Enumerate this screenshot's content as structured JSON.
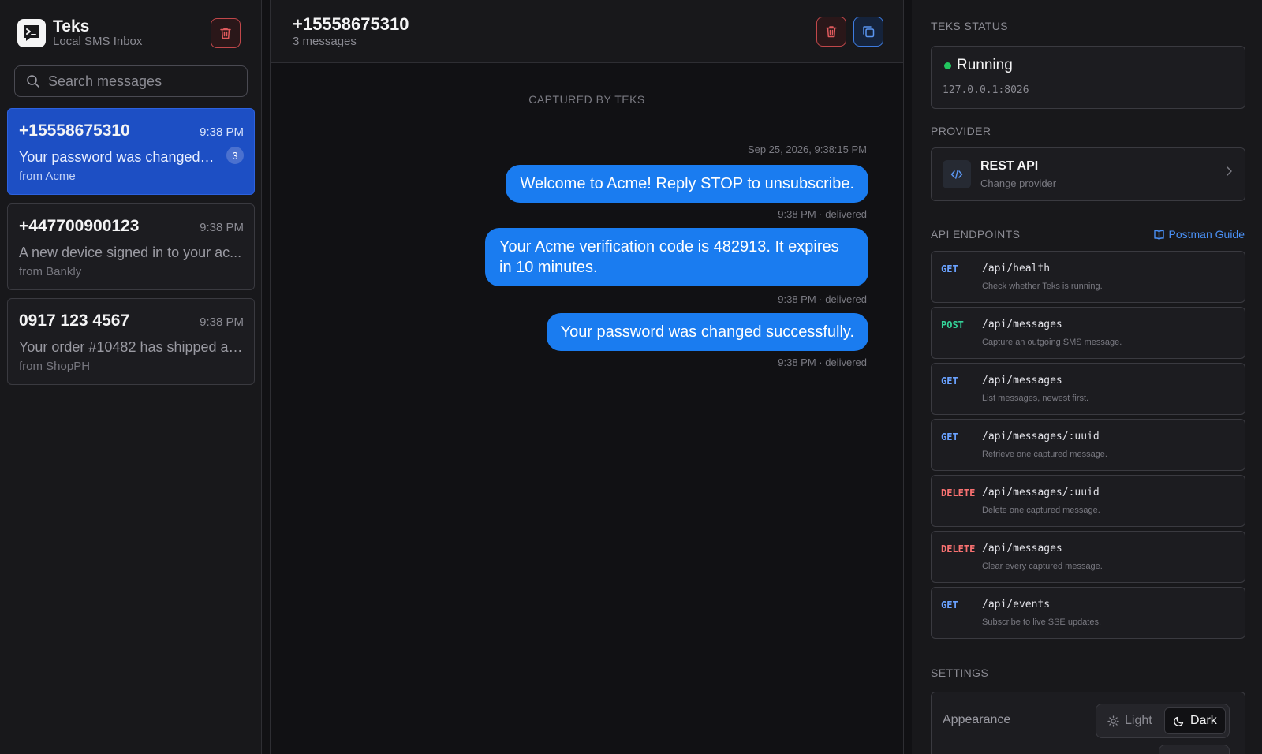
{
  "app": {
    "name": "Teks",
    "subtitle": "Local SMS Inbox"
  },
  "search": {
    "placeholder": "Search messages"
  },
  "conversations": [
    {
      "number": "+15558675310",
      "time": "9:38 PM",
      "preview": "Your password was changed s...",
      "from": "from Acme",
      "unread": "3",
      "active": true
    },
    {
      "number": "+447700900123",
      "time": "9:38 PM",
      "preview": "A new device signed in to your ac...",
      "from": "from Bankly"
    },
    {
      "number": "0917 123 4567",
      "time": "9:38 PM",
      "preview": "Your order #10482 has shipped an...",
      "from": "from ShopPH"
    }
  ],
  "chat": {
    "title": "+15558675310",
    "count": "3 messages",
    "captured_label": "CAPTURED BY TEKS",
    "timestamp": "Sep 25, 2026, 9:38:15 PM",
    "messages": [
      {
        "text": "Welcome to Acme! Reply STOP to unsubscribe.",
        "meta": "9:38 PM · delivered"
      },
      {
        "text": "Your Acme verification code is 482913. It expires in 10 minutes.",
        "meta": "9:38 PM · delivered"
      },
      {
        "text": "Your password was changed successfully.",
        "meta": "9:38 PM · delivered"
      }
    ]
  },
  "panel": {
    "status_heading": "TEKS STATUS",
    "status": "Running",
    "address": "127.0.0.1:8026",
    "provider_heading": "PROVIDER",
    "provider_name": "REST API",
    "provider_action": "Change provider",
    "endpoints_heading": "API ENDPOINTS",
    "guide_label": "Postman Guide",
    "endpoints": [
      {
        "method": "GET",
        "path": "/api/health",
        "desc": "Check whether Teks is running."
      },
      {
        "method": "POST",
        "path": "/api/messages",
        "desc": "Capture an outgoing SMS message."
      },
      {
        "method": "GET",
        "path": "/api/messages",
        "desc": "List messages, newest first."
      },
      {
        "method": "GET",
        "path": "/api/messages/:uuid",
        "desc": "Retrieve one captured message."
      },
      {
        "method": "DELETE",
        "path": "/api/messages/:uuid",
        "desc": "Delete one captured message."
      },
      {
        "method": "DELETE",
        "path": "/api/messages",
        "desc": "Clear every captured message."
      },
      {
        "method": "GET",
        "path": "/api/events",
        "desc": "Subscribe to live SSE updates."
      }
    ],
    "settings_heading": "SETTINGS",
    "appearance_label": "Appearance",
    "theme_light": "Light",
    "theme_dark": "Dark"
  },
  "colors": {
    "accent": "#1a7cf0",
    "active_conversation": "#1d4fc4",
    "running": "#22c55e",
    "danger": "#c0474a"
  },
  "icons": [
    "terminal-chat-logo-icon",
    "trash-icon",
    "copy-icon",
    "search-icon",
    "code-icon",
    "chevron-right-icon",
    "book-icon",
    "sun-icon",
    "moon-icon"
  ]
}
